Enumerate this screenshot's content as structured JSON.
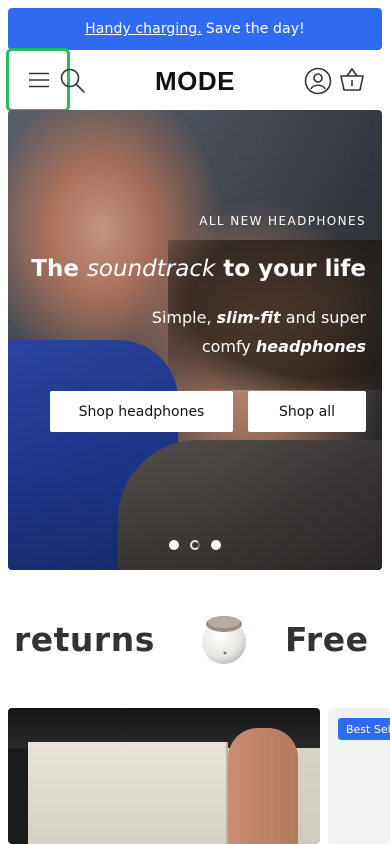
{
  "announcement": {
    "link_text": "Handy charging.",
    "text": "Save the day!"
  },
  "header": {
    "logo": "MODE",
    "icons": [
      "menu-icon",
      "search-icon",
      "account-icon",
      "basket-icon"
    ]
  },
  "hero": {
    "eyebrow": "ALL NEW HEADPHONES",
    "title_prefix": "The",
    "title_italic": "soundtrack",
    "title_suffix": "to your life",
    "sub_1": "Simple,",
    "sub_bold_1": "slim-fit",
    "sub_2": "and super comfy",
    "sub_bold_2": "headphones",
    "button_primary": "Shop headphones",
    "button_secondary": "Shop all",
    "slides_total": 3,
    "slide_active": 2
  },
  "marquee": {
    "word_1": "returns",
    "word_2": "Free"
  },
  "products": {
    "badge": "Best Sel"
  },
  "colors": {
    "accent": "#2f6bf0",
    "highlight": "#21c25b"
  }
}
